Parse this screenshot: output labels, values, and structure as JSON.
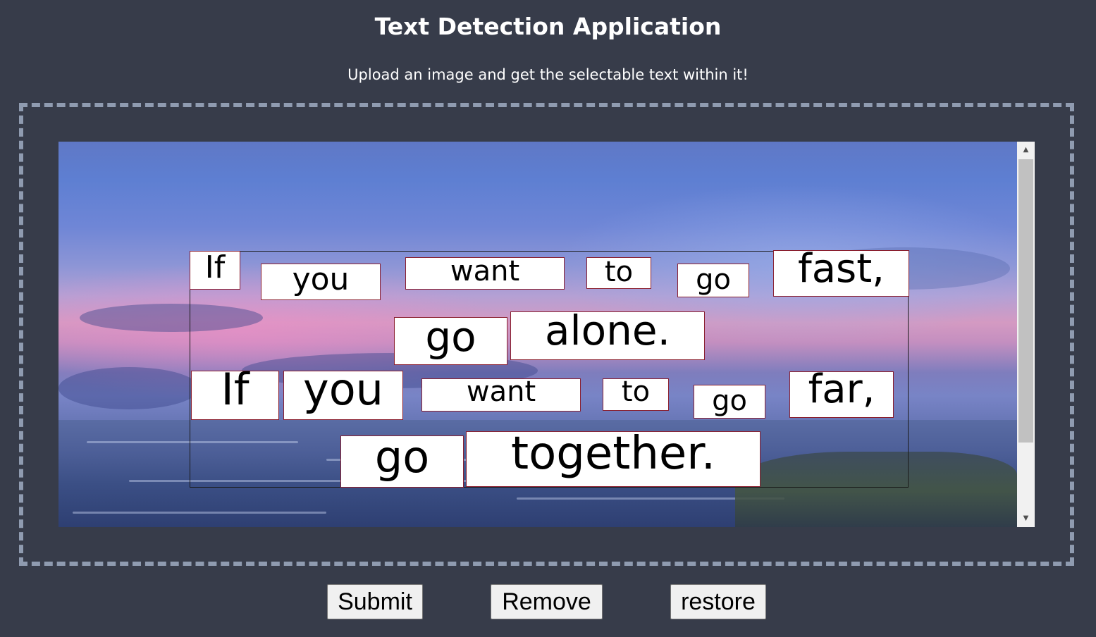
{
  "header": {
    "title": "Text Detection Application",
    "subtitle": "Upload an image and get the selectable text within it!"
  },
  "scrollbar": {
    "up_arrow": "▲",
    "down_arrow": "▼"
  },
  "detected_words": [
    "If",
    "you",
    "want",
    "to",
    "go",
    "fast,",
    "go",
    "alone.",
    "If",
    "you",
    "want",
    "to",
    "go",
    "far,",
    "go",
    "together."
  ],
  "buttons": {
    "submit": "Submit",
    "remove": "Remove",
    "restore": "restore"
  },
  "colors": {
    "background": "#373c4a",
    "dropzone_border": "#8f9bb0",
    "word_box_border": "#8a1f2f"
  }
}
